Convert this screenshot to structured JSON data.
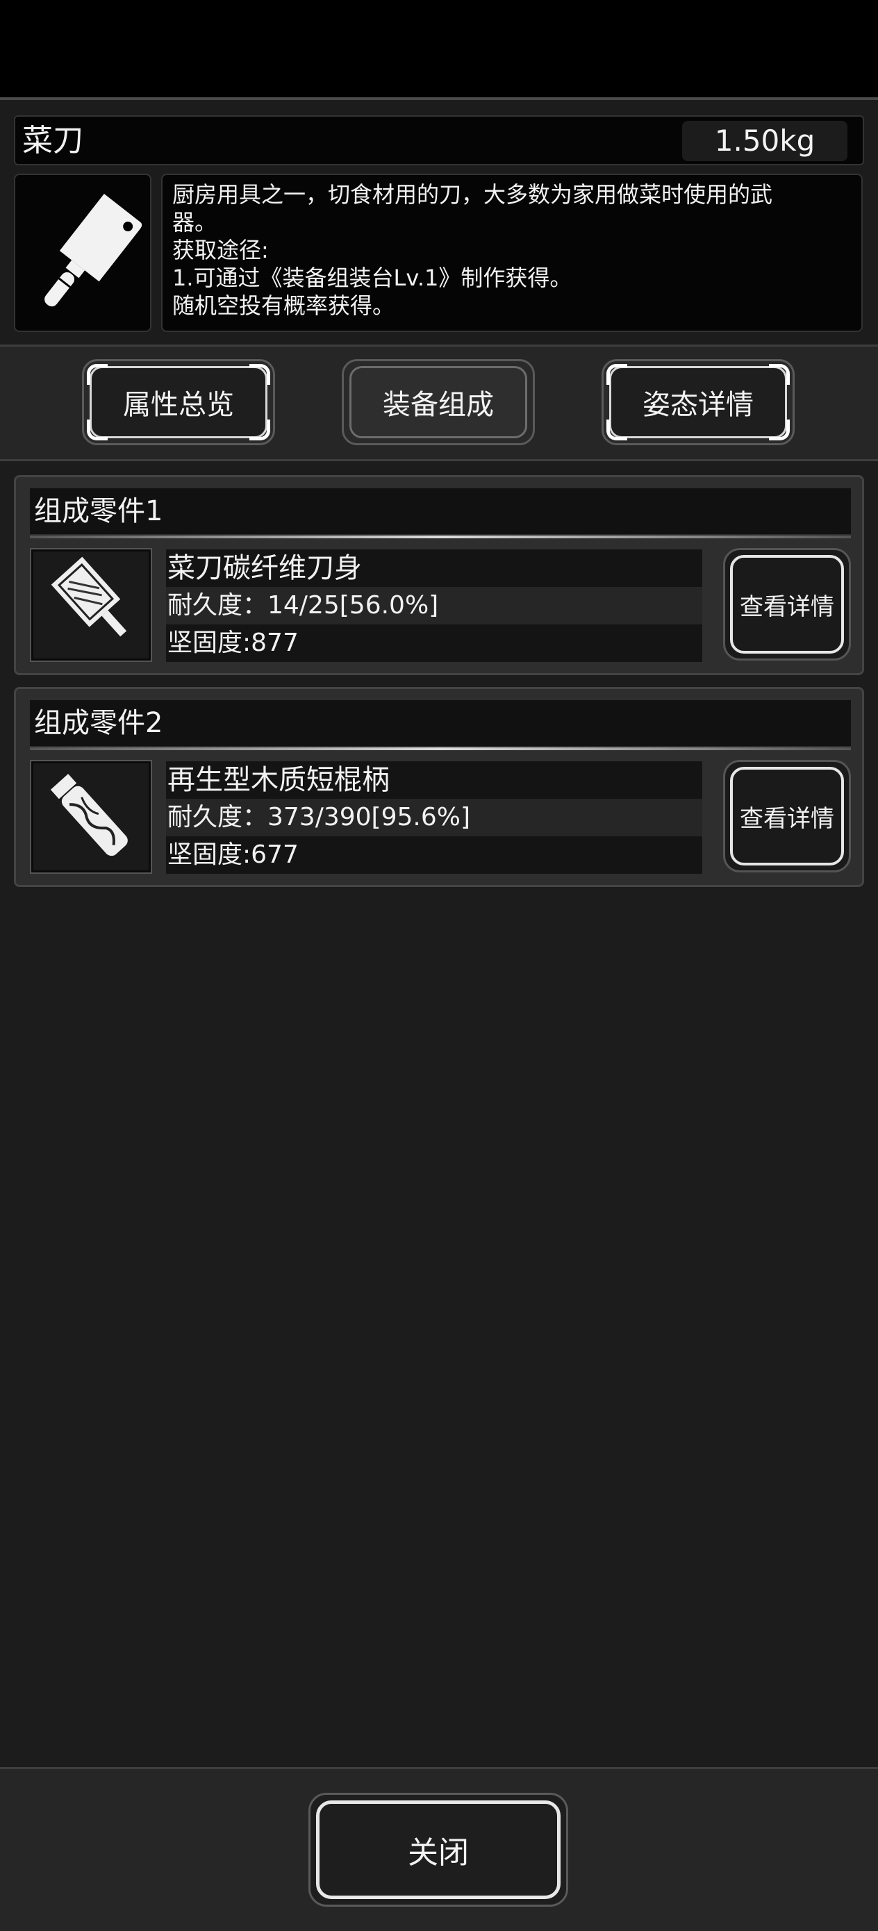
{
  "item": {
    "name": "菜刀",
    "weight": "1.50kg",
    "icon": "cleaver-icon",
    "description_lines": [
      "厨房用具之一，切食材用的刀，大多数为家用做菜时使用的武",
      "器。",
      "获取途径:",
      "1.可通过《装备组装台Lv.1》制作获得。",
      "随机空投有概率获得。"
    ]
  },
  "tabs": [
    {
      "label": "属性总览",
      "active": false
    },
    {
      "label": "装备组成",
      "active": true
    },
    {
      "label": "姿态详情",
      "active": false
    }
  ],
  "parts": [
    {
      "header": "组成零件1",
      "icon": "blade-icon",
      "name": "菜刀碳纤维刀身",
      "durability": "耐久度：14/25[56.0%]",
      "hardness": "坚固度:877",
      "button": "查看详情"
    },
    {
      "header": "组成零件2",
      "icon": "handle-icon",
      "name": "再生型木质短棍柄",
      "durability": "耐久度：373/390[95.6%]",
      "hardness": "坚固度:677",
      "button": "查看详情"
    }
  ],
  "footer": {
    "close_label": "关闭"
  }
}
